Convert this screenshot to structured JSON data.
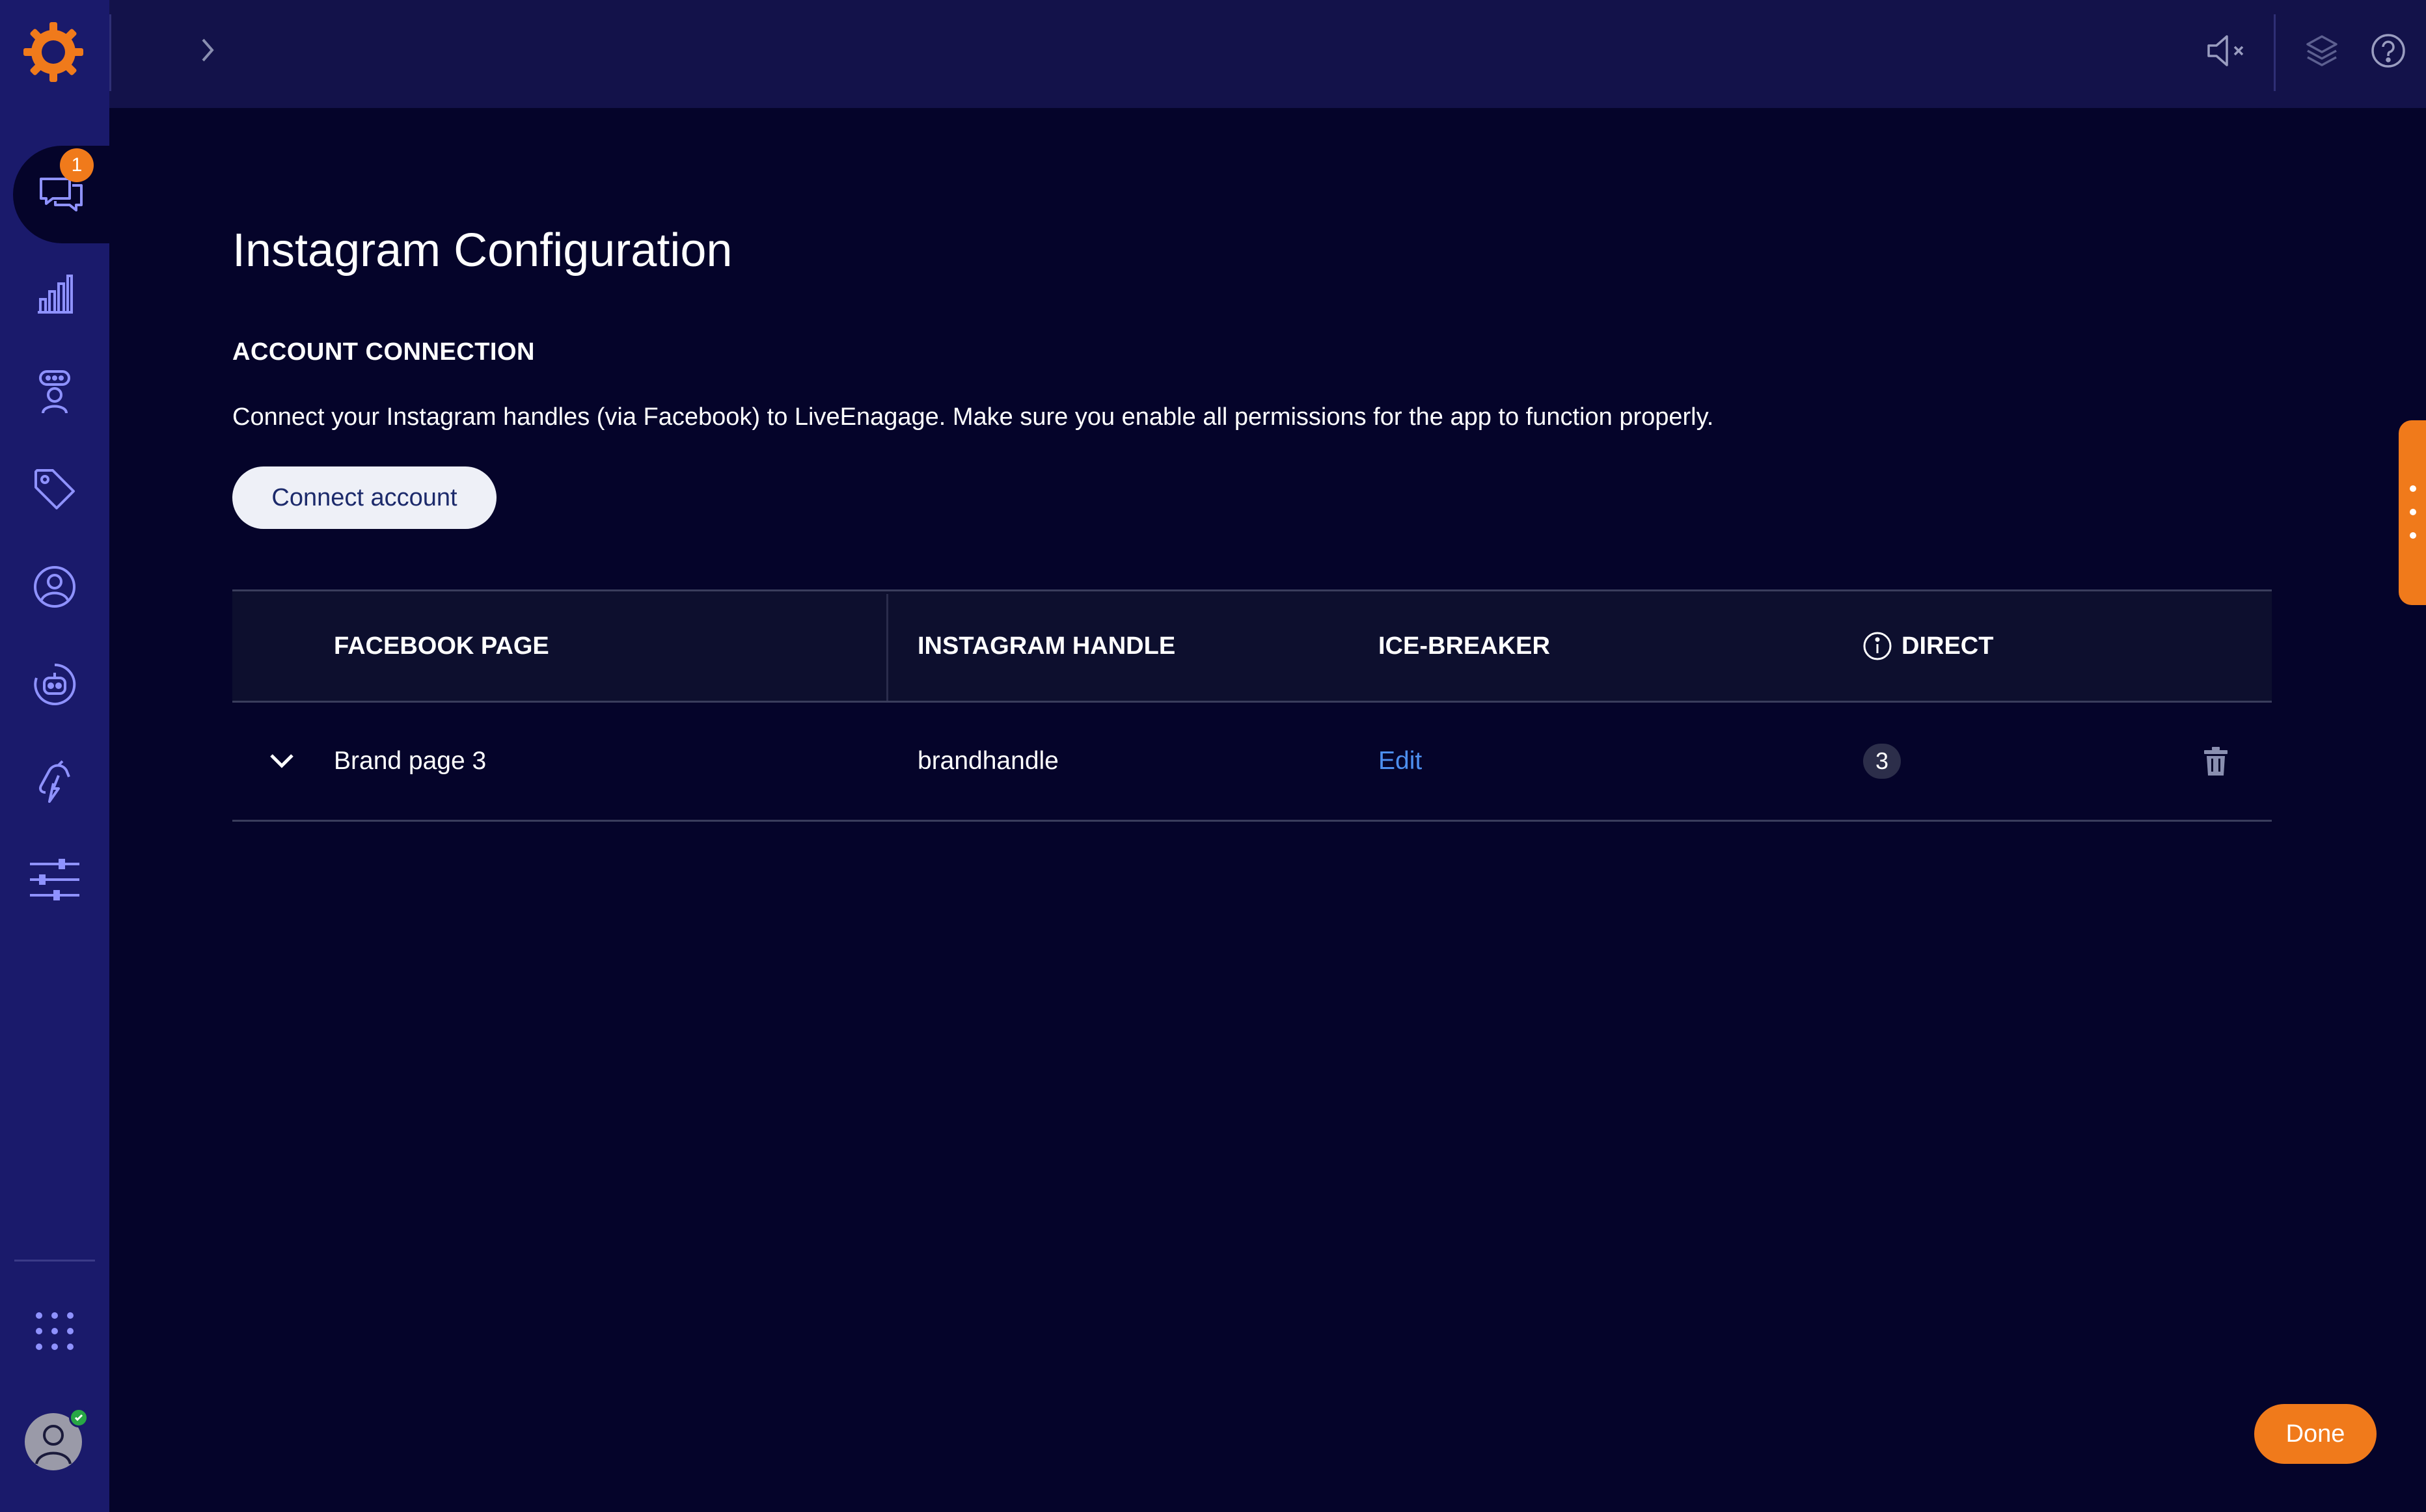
{
  "topbar": {
    "icons": [
      "chevron-right-icon",
      "sound-off-icon",
      "layers-icon",
      "help-icon"
    ]
  },
  "sidebar": {
    "badge_count": "1",
    "items": [
      {
        "icon": "conversations-icon",
        "active": true
      },
      {
        "icon": "analytics-icon"
      },
      {
        "icon": "agent-icon"
      },
      {
        "icon": "tag-icon"
      },
      {
        "icon": "user-profile-icon"
      },
      {
        "icon": "bot-icon"
      },
      {
        "icon": "automation-icon"
      },
      {
        "icon": "settings-sliders-icon"
      }
    ],
    "bottom": [
      "apps-grid-icon",
      "avatar"
    ]
  },
  "main": {
    "title": "Instagram Configuration",
    "section_title": "ACCOUNT CONNECTION",
    "description": "Connect your Instagram handles (via Facebook) to LiveEnagage. Make sure you enable all permissions for the app to function properly.",
    "connect_button": "Connect account",
    "table": {
      "headers": [
        "FACEBOOK PAGE",
        "INSTAGRAM HANDLE",
        "ICE-BREAKER",
        "DIRECT"
      ],
      "rows": [
        {
          "facebook_page": "Brand page 3",
          "instagram_handle": "brandhandle",
          "ice_breaker": "Edit",
          "direct": "3"
        }
      ]
    },
    "done_button": "Done"
  },
  "colors": {
    "background": "#05042a",
    "sidebar": "#1a1a6b",
    "accent": "#f07a1b",
    "link": "#4d8ff0"
  }
}
